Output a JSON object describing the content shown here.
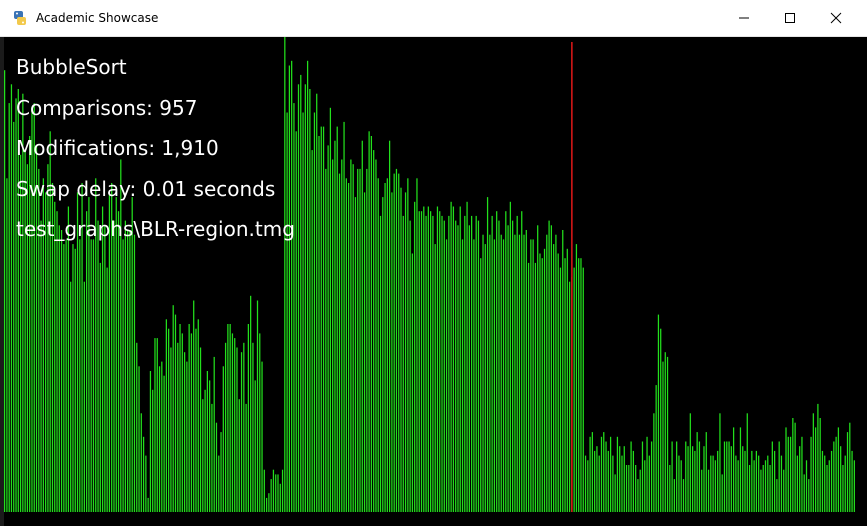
{
  "window": {
    "title": "Academic Showcase",
    "controls": {
      "minimize": "minimize",
      "maximize": "maximize",
      "close": "close"
    }
  },
  "overlay": {
    "algorithm": "BubbleSort",
    "comparisons": "Comparisons: 957",
    "modifications": "Modifications: 1,910",
    "swap_delay": "Swap delay: 0.01 seconds",
    "file": "test_graphs\\BLR-region.tmg"
  },
  "colors": {
    "bar": "#22e01c",
    "bar_edge": "#0b4d0a",
    "highlight": "#e01818",
    "background": "#000000"
  },
  "chart_data": {
    "type": "bar",
    "ylim": [
      0,
      100
    ],
    "highlight_index": 249,
    "values": [
      94,
      71,
      87,
      91,
      83,
      88,
      90,
      76,
      89,
      77,
      74,
      80,
      86,
      87,
      78,
      73,
      62,
      71,
      68,
      74,
      81,
      70,
      66,
      64,
      61,
      60,
      57,
      58,
      65,
      49,
      57,
      56,
      68,
      58,
      70,
      49,
      64,
      67,
      58,
      58,
      71,
      62,
      53,
      65,
      61,
      52,
      68,
      70,
      62,
      67,
      64,
      75,
      58,
      62,
      60,
      60,
      67,
      59,
      36,
      31,
      21,
      16,
      12,
      3,
      30,
      26,
      37,
      37,
      31,
      32,
      29,
      41,
      39,
      35,
      44,
      42,
      36,
      40,
      38,
      34,
      32,
      40,
      38,
      45,
      39,
      41,
      35,
      24,
      26,
      30,
      28,
      23,
      33,
      19,
      12,
      17,
      31,
      36,
      40,
      40,
      38,
      37,
      35,
      24,
      34,
      36,
      23,
      40,
      46,
      36,
      28,
      45,
      38,
      32,
      9,
      3,
      4,
      7,
      9,
      8,
      8,
      6,
      9,
      102,
      85,
      95,
      96,
      87,
      81,
      91,
      93,
      85,
      91,
      96,
      90,
      77,
      85,
      89,
      80,
      82,
      82,
      73,
      78,
      86,
      75,
      79,
      82,
      72,
      75,
      83,
      71,
      70,
      75,
      74,
      67,
      73,
      73,
      79,
      68,
      73,
      81,
      80,
      77,
      75,
      71,
      63,
      67,
      70,
      71,
      79,
      68,
      72,
      73,
      72,
      69,
      63,
      68,
      71,
      62,
      55,
      66,
      71,
      64,
      64,
      65,
      63,
      65,
      64,
      63,
      57,
      65,
      64,
      63,
      62,
      58,
      63,
      66,
      65,
      62,
      61,
      65,
      58,
      63,
      66,
      61,
      63,
      58,
      63,
      62,
      54,
      59,
      57,
      67,
      59,
      63,
      58,
      64,
      62,
      59,
      58,
      64,
      61,
      66,
      62,
      59,
      63,
      59,
      64,
      59,
      60,
      53,
      58,
      58,
      53,
      61,
      55,
      54,
      56,
      59,
      62,
      61,
      57,
      59,
      55,
      52,
      60,
      54,
      56,
      49,
      50,
      52,
      57,
      54,
      54,
      52,
      12,
      11,
      16,
      17,
      13,
      14,
      12,
      16,
      17,
      15,
      13,
      16,
      12,
      8,
      16,
      14,
      12,
      14,
      10,
      10,
      15,
      13,
      10,
      7,
      9,
      15,
      11,
      16,
      12,
      15,
      21,
      27,
      42,
      39,
      32,
      34,
      33,
      10,
      15,
      7,
      15,
      12,
      11,
      7,
      15,
      14,
      21,
      14,
      13,
      17,
      15,
      9,
      14,
      17,
      9,
      12,
      12,
      11,
      13,
      21,
      8,
      15,
      15,
      15,
      14,
      18,
      12,
      11,
      18,
      14,
      13,
      21,
      10,
      13,
      11,
      13,
      12,
      9,
      10,
      11,
      12,
      10,
      15,
      13,
      7,
      15,
      12,
      9,
      18,
      16,
      16,
      20,
      19,
      12,
      14,
      16,
      8,
      11,
      7,
      16,
      21,
      18,
      23,
      20,
      13,
      12,
      10,
      11,
      13,
      15,
      16,
      18,
      14,
      10,
      12,
      17,
      19,
      13,
      11
    ]
  }
}
